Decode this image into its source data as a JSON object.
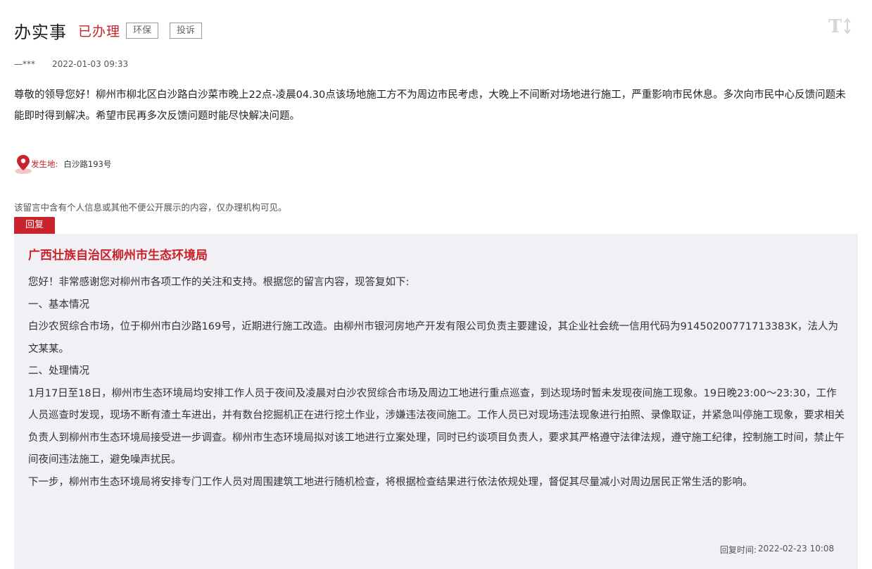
{
  "header": {
    "title": "办实事",
    "status": "已办理",
    "tags": [
      "环保",
      "投诉"
    ],
    "font_icon": "font-size-icon"
  },
  "meta": {
    "author": "—***",
    "date": "2022-01-03 09:33"
  },
  "message": {
    "body": "尊敬的领导您好！柳州市柳北区白沙路白沙菜市晚上22点-凌晨04.30点该场地施工方不为周边市民考虑，大晚上不间断对场地进行施工，严重影响市民休息。多次向市民中心反馈问题未能即时得到解决。希望市民再多次反馈问题时能尽快解决问题。"
  },
  "location": {
    "icon": "map-pin-icon",
    "label": "发生地:",
    "value": "白沙路193号"
  },
  "privacy_note": "该留言中含有个人信息或其他不便公开展示的内容，仅办理机构可见。",
  "reply": {
    "tab_label": "回复",
    "org": "广西壮族自治区柳州市生态环境局",
    "paragraphs": [
      "您好！非常感谢您对柳州市各项工作的关注和支持。根据您的留言内容，现答复如下:",
      "一、基本情况",
      "白沙农贸综合市场，位于柳州市白沙路169号，近期进行施工改造。由柳州市银河房地产开发有限公司负责主要建设，其企业社会统一信用代码为91450200771713383K，法人为文某某。",
      "二、处理情况",
      "1月17日至18日，柳州市生态环境局均安排工作人员于夜间及凌晨对白沙农贸综合市场及周边工地进行重点巡查，到达现场时暂未发现夜间施工现象。19日晚23:00～23:30，工作人员巡查时发现，现场不断有渣土车进出，并有数台挖掘机正在进行挖土作业，涉嫌违法夜间施工。工作人员已对现场违法现象进行拍照、录像取证，并紧急叫停施工现象，要求相关负责人到柳州市生态环境局接受进一步调查。柳州市生态环境局拟对该工地进行立案处理，同时已约谈项目负责人，要求其严格遵守法律法规，遵守施工纪律，控制施工时间，禁止午间夜间违法施工，避免噪声扰民。",
      "下一步，柳州市生态环境局将安排专门工作人员对周围建筑工地进行随机检查，将根据检查结果进行依法依规处理，督促其尽量减小对周边居民正常生活的影响。"
    ],
    "time_label": "回复时间:",
    "time_value": "2022-02-23 10:08"
  },
  "colors": {
    "accent": "#c8222a",
    "reply_bg": "#f0f0f5",
    "text": "#222222",
    "muted": "#555555"
  }
}
